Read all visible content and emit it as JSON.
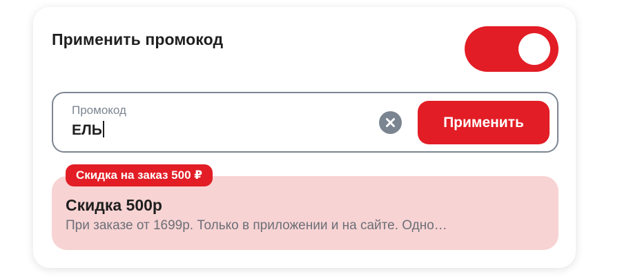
{
  "promo_section": {
    "title": "Применить промокод",
    "toggle_on": true
  },
  "promo_input": {
    "label": "Промокод",
    "value": "ЕЛЬ",
    "apply_label": "Применить"
  },
  "discount": {
    "badge": "Скидка на заказ 500 ₽",
    "title": "Скидка 500р",
    "description": "При заказе от 1699р. Только в приложении и на сайте. Одно…"
  },
  "colors": {
    "accent": "#e21d25",
    "discount_bg": "#f8d3d3",
    "muted": "#7b8591"
  },
  "icons": {
    "clear": "close-icon"
  }
}
